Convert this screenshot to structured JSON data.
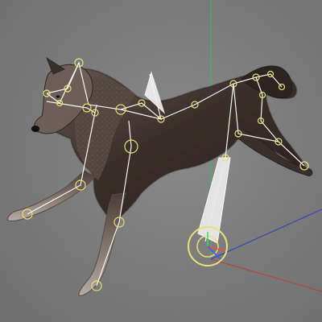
{
  "viewport": {
    "kind": "3d-viewport",
    "subject": "wolf-model-with-rig",
    "background_color": "#7b7b7b",
    "colors": {
      "axis_x": "#c43a3a",
      "axis_y": "#2fbf5a",
      "axis_z": "#2f3fbf",
      "joint": "#e8e07a",
      "bone": "#ffffff",
      "fur_dark": "#3b2f2a",
      "fur_light": "#9b8f86"
    }
  }
}
